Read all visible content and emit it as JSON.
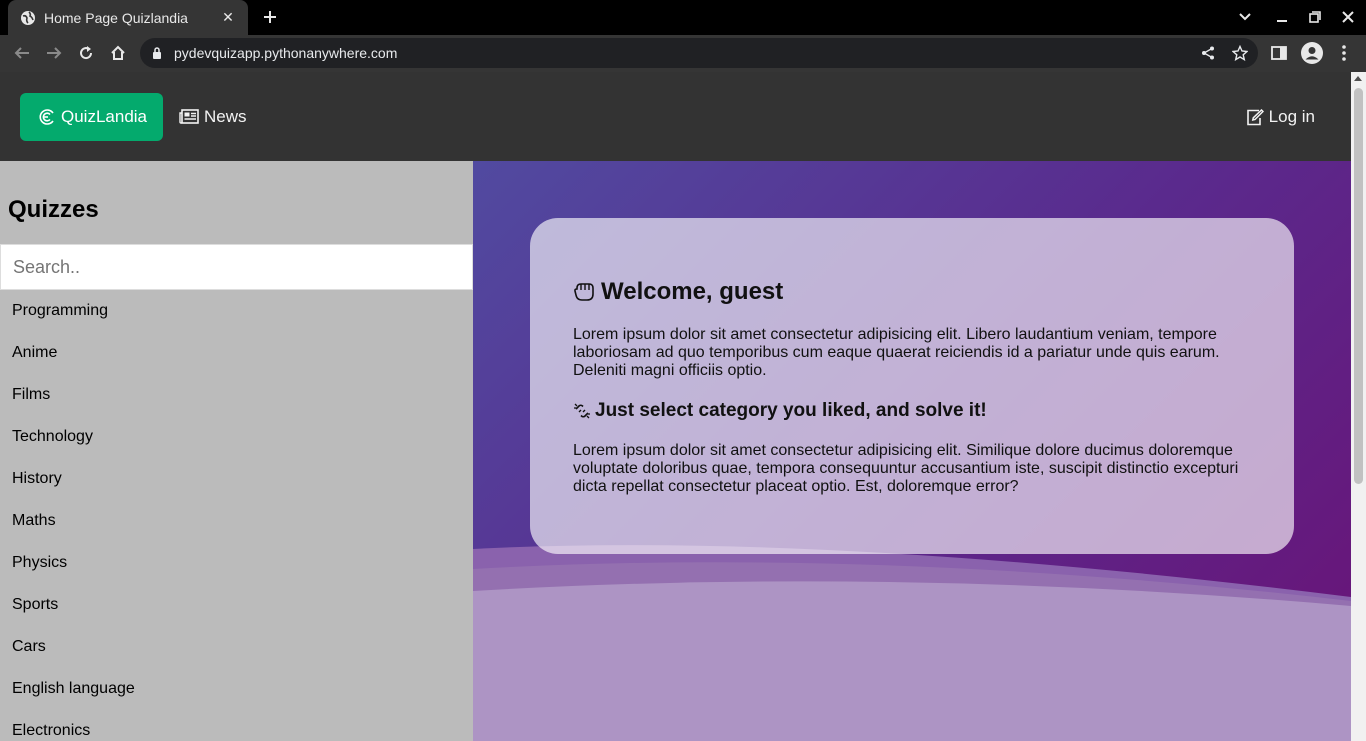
{
  "browser": {
    "tab_title": "Home Page Quizlandia",
    "url": "pydevquizapp.pythonanywhere.com"
  },
  "site_nav": {
    "brand_label": "QuizLandia",
    "news_label": "News",
    "login_label": "Log in"
  },
  "sidebar": {
    "title": "Quizzes",
    "search_placeholder": "Search..",
    "categories": [
      "Programming",
      "Anime",
      "Films",
      "Technology",
      "History",
      "Maths",
      "Physics",
      "Sports",
      "Cars",
      "English language",
      "Electronics"
    ]
  },
  "welcome_card": {
    "heading": "Welcome, guest",
    "paragraph1": "Lorem ipsum dolor sit amet consectetur adipisicing elit. Libero laudantium veniam, tempore laboriosam ad quo temporibus cum eaque quaerat reiciendis id a pariatur unde quis earum. Deleniti magni officiis optio.",
    "subheading": "Just select category you liked, and solve it!",
    "paragraph2": "Lorem ipsum dolor sit amet consectetur adipisicing elit. Similique dolore ducimus doloremque voluptate doloribus quae, tempora consequuntur accusantium iste, suscipit distinctio excepturi dicta repellat consectetur placeat optio. Est, doloremque error?"
  },
  "colors": {
    "brand_green": "#04aa6d",
    "nav_dark": "#333333",
    "sidebar_gray": "#bbbbbb",
    "hero_purple": "#5a2a8d"
  }
}
